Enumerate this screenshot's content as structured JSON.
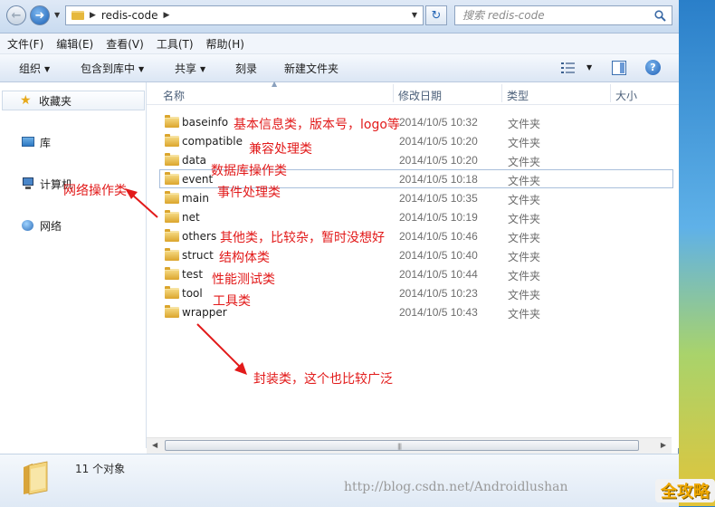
{
  "address_bar": {
    "path": "redis-code",
    "search_placeholder": "搜索 redis-code"
  },
  "menu": [
    "文件(F)",
    "编辑(E)",
    "查看(V)",
    "工具(T)",
    "帮助(H)"
  ],
  "toolbar": {
    "organize": "组织",
    "include_in_library": "包含到库中",
    "share": "共享",
    "burn": "刻录",
    "new_folder": "新建文件夹"
  },
  "nav": {
    "favorites": "收藏夹",
    "library": "库",
    "computer": "计算机",
    "network": "网络"
  },
  "columns": {
    "name": "名称",
    "date": "修改日期",
    "type": "类型",
    "size": "大小"
  },
  "files": [
    {
      "name": "baseinfo",
      "date": "2014/10/5 10:32",
      "type": "文件夹"
    },
    {
      "name": "compatible",
      "date": "2014/10/5 10:20",
      "type": "文件夹"
    },
    {
      "name": "data",
      "date": "2014/10/5 10:20",
      "type": "文件夹"
    },
    {
      "name": "event",
      "date": "2014/10/5 10:18",
      "type": "文件夹"
    },
    {
      "name": "main",
      "date": "2014/10/5 10:35",
      "type": "文件夹"
    },
    {
      "name": "net",
      "date": "2014/10/5 10:19",
      "type": "文件夹"
    },
    {
      "name": "others",
      "date": "2014/10/5 10:46",
      "type": "文件夹"
    },
    {
      "name": "struct",
      "date": "2014/10/5 10:40",
      "type": "文件夹"
    },
    {
      "name": "test",
      "date": "2014/10/5 10:44",
      "type": "文件夹"
    },
    {
      "name": "tool",
      "date": "2014/10/5 10:23",
      "type": "文件夹"
    },
    {
      "name": "wrapper",
      "date": "2014/10/5 10:43",
      "type": "文件夹"
    }
  ],
  "status": {
    "item_count": "11 个对象"
  },
  "annotations": {
    "baseinfo": "基本信息类，版本号，logo等",
    "compatible": "兼容处理类",
    "data": "数据库操作类",
    "main": "事件处理类",
    "net": "网络操作类",
    "others": "其他类，比较杂，暂时没想好",
    "struct": "结构体类",
    "test": "性能测试类",
    "tool": "工具类",
    "wrapper": "封装类，这个也比较广泛"
  },
  "watermark": {
    "url": "http://blog.csdn.net/Androidlushan",
    "logo": "全攻略"
  },
  "colors": {
    "annotation": "#e21a1a",
    "folder": "#e6b83c",
    "selection_border": "#a9bfdb"
  }
}
